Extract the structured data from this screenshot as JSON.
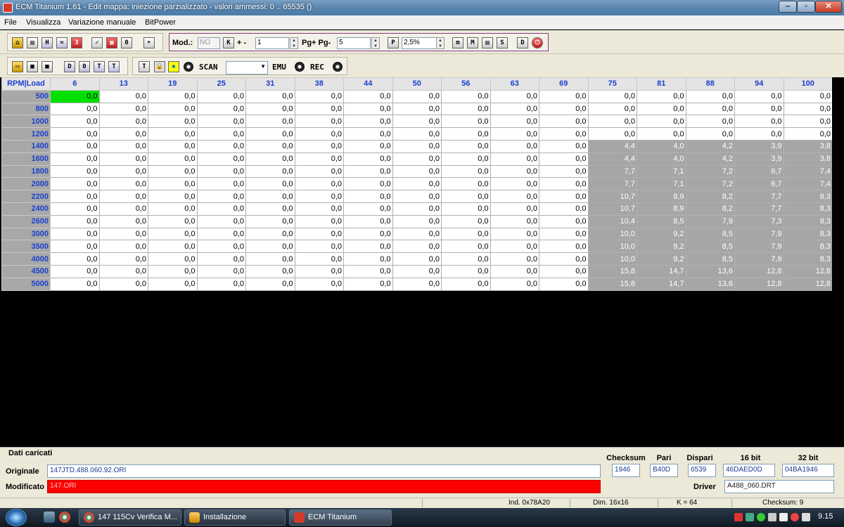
{
  "window": {
    "title": "ECM Titanium 1.61 - Edit mappa: iniezione parzializzato - valori ammessi: 0 .. 65535 ()",
    "minimize": "‒",
    "maximize": "▫",
    "close": "✕"
  },
  "menu": [
    "File",
    "Visualizza",
    "Variazione manuale",
    "BitPower"
  ],
  "toolbar1": {
    "mod_label": "Mod.:",
    "mod_value": "NO",
    "k_button": "K",
    "plusminus_label": "+ -",
    "plusminus_value": "1",
    "pg_label": "Pg+ Pg-",
    "pg_value": "5",
    "p_button": "P",
    "percent_value": "2,5%",
    "m_buttons": [
      "m",
      "M",
      "▤",
      "S"
    ],
    "d_button": "D"
  },
  "toolbar2": {
    "view_buttons": [
      "D",
      "0",
      "T",
      "T"
    ],
    "t_button": "T",
    "scan_label": "SCAN",
    "scan_value": "",
    "emu_label": "EMU",
    "rec_label": "REC"
  },
  "grid": {
    "corner": "RPM|Load",
    "columns": [
      "6",
      "13",
      "19",
      "25",
      "31",
      "38",
      "44",
      "50",
      "56",
      "63",
      "69",
      "75",
      "81",
      "88",
      "94",
      "100"
    ],
    "highlight_from_col": 11,
    "highlight_from_row": 4,
    "selected": [
      0,
      0
    ],
    "rows": [
      {
        "rpm": "500",
        "values": [
          "0,0",
          "0,0",
          "0,0",
          "0,0",
          "0,0",
          "0,0",
          "0,0",
          "0,0",
          "0,0",
          "0,0",
          "0,0",
          "0,0",
          "0,0",
          "0,0",
          "0,0",
          "0,0"
        ]
      },
      {
        "rpm": "800",
        "values": [
          "0,0",
          "0,0",
          "0,0",
          "0,0",
          "0,0",
          "0,0",
          "0,0",
          "0,0",
          "0,0",
          "0,0",
          "0,0",
          "0,0",
          "0,0",
          "0,0",
          "0,0",
          "0,0"
        ]
      },
      {
        "rpm": "1000",
        "values": [
          "0,0",
          "0,0",
          "0,0",
          "0,0",
          "0,0",
          "0,0",
          "0,0",
          "0,0",
          "0,0",
          "0,0",
          "0,0",
          "0,0",
          "0,0",
          "0,0",
          "0,0",
          "0,0"
        ]
      },
      {
        "rpm": "1200",
        "values": [
          "0,0",
          "0,0",
          "0,0",
          "0,0",
          "0,0",
          "0,0",
          "0,0",
          "0,0",
          "0,0",
          "0,0",
          "0,0",
          "0,0",
          "0,0",
          "0,0",
          "0,0",
          "0,0"
        ]
      },
      {
        "rpm": "1400",
        "values": [
          "0,0",
          "0,0",
          "0,0",
          "0,0",
          "0,0",
          "0,0",
          "0,0",
          "0,0",
          "0,0",
          "0,0",
          "0,0",
          "4,4",
          "4,0",
          "4,2",
          "3,9",
          "3,8"
        ]
      },
      {
        "rpm": "1600",
        "values": [
          "0,0",
          "0,0",
          "0,0",
          "0,0",
          "0,0",
          "0,0",
          "0,0",
          "0,0",
          "0,0",
          "0,0",
          "0,0",
          "4,4",
          "4,0",
          "4,2",
          "3,9",
          "3,8"
        ]
      },
      {
        "rpm": "1800",
        "values": [
          "0,0",
          "0,0",
          "0,0",
          "0,0",
          "0,0",
          "0,0",
          "0,0",
          "0,0",
          "0,0",
          "0,0",
          "0,0",
          "7,7",
          "7,1",
          "7,2",
          "6,7",
          "7,4"
        ]
      },
      {
        "rpm": "2000",
        "values": [
          "0,0",
          "0,0",
          "0,0",
          "0,0",
          "0,0",
          "0,0",
          "0,0",
          "0,0",
          "0,0",
          "0,0",
          "0,0",
          "7,7",
          "7,1",
          "7,2",
          "6,7",
          "7,4"
        ]
      },
      {
        "rpm": "2200",
        "values": [
          "0,0",
          "0,0",
          "0,0",
          "0,0",
          "0,0",
          "0,0",
          "0,0",
          "0,0",
          "0,0",
          "0,0",
          "0,0",
          "10,7",
          "8,9",
          "8,2",
          "7,7",
          "8,3"
        ]
      },
      {
        "rpm": "2400",
        "values": [
          "0,0",
          "0,0",
          "0,0",
          "0,0",
          "0,0",
          "0,0",
          "0,0",
          "0,0",
          "0,0",
          "0,0",
          "0,0",
          "10,7",
          "8,9",
          "8,2",
          "7,7",
          "8,3"
        ]
      },
      {
        "rpm": "2600",
        "values": [
          "0,0",
          "0,0",
          "0,0",
          "0,0",
          "0,0",
          "0,0",
          "0,0",
          "0,0",
          "0,0",
          "0,0",
          "0,0",
          "10,4",
          "8,5",
          "7,9",
          "7,3",
          "8,3"
        ]
      },
      {
        "rpm": "3000",
        "values": [
          "0,0",
          "0,0",
          "0,0",
          "0,0",
          "0,0",
          "0,0",
          "0,0",
          "0,0",
          "0,0",
          "0,0",
          "0,0",
          "10,0",
          "9,2",
          "8,5",
          "7,9",
          "8,3"
        ]
      },
      {
        "rpm": "3500",
        "values": [
          "0,0",
          "0,0",
          "0,0",
          "0,0",
          "0,0",
          "0,0",
          "0,0",
          "0,0",
          "0,0",
          "0,0",
          "0,0",
          "10,0",
          "9,2",
          "8,5",
          "7,9",
          "8,3"
        ]
      },
      {
        "rpm": "4000",
        "values": [
          "0,0",
          "0,0",
          "0,0",
          "0,0",
          "0,0",
          "0,0",
          "0,0",
          "0,0",
          "0,0",
          "0,0",
          "0,0",
          "10,0",
          "9,2",
          "8,5",
          "7,9",
          "8,3"
        ]
      },
      {
        "rpm": "4500",
        "values": [
          "0,0",
          "0,0",
          "0,0",
          "0,0",
          "0,0",
          "0,0",
          "0,0",
          "0,0",
          "0,0",
          "0,0",
          "0,0",
          "15,8",
          "14,7",
          "13,6",
          "12,8",
          "12,8"
        ]
      },
      {
        "rpm": "5000",
        "values": [
          "0,0",
          "0,0",
          "0,0",
          "0,0",
          "0,0",
          "0,0",
          "0,0",
          "0,0",
          "0,0",
          "0,0",
          "0,0",
          "15,8",
          "14,7",
          "13,6",
          "12,8",
          "12,8"
        ]
      }
    ]
  },
  "info": {
    "section_title": "Dati caricati",
    "originale_label": "Originale",
    "originale_value": "147JTD.488.060.92.ORI",
    "modificato_label": "Modificato",
    "modificato_value": "147.ORI",
    "checksum_label": "Checksum",
    "checksum_value": "1946",
    "pari_label": "Pari",
    "pari_value": "B40D",
    "dispari_label": "Dispari",
    "dispari_value": "6539",
    "bit16_label": "16 bit",
    "bit16_value": "46DAED0D",
    "bit32_label": "32 bit",
    "bit32_value": "04BA1946",
    "driver_label": "Driver",
    "driver_value": "A488_060.DRT"
  },
  "status": {
    "ind": "Ind. 0x78A20",
    "dim": "Dim. 16x16",
    "k": "K = 64",
    "checksum": "Checksum: 9"
  },
  "taskbar": {
    "tasks": [
      "147 115Cv Verifica M...",
      "Installazione",
      "ECM Titanium"
    ],
    "clock": "9.15"
  },
  "colors": {
    "header_text": "#1a3fcf",
    "highlight_cell": "#a6a6a6",
    "selected_cell": "#00e000",
    "modified_bg": "#ff0000"
  }
}
